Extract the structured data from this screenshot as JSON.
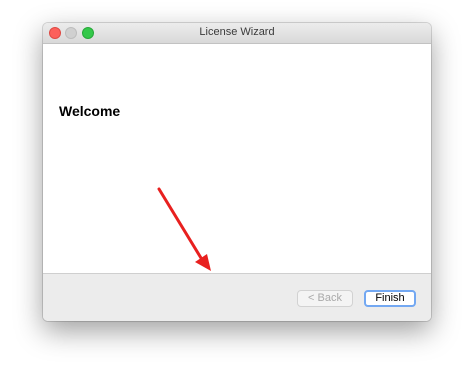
{
  "window": {
    "title": "License Wizard"
  },
  "page": {
    "heading": "Welcome"
  },
  "buttons": {
    "back_label": "< Back",
    "finish_label": "Finish"
  },
  "colors": {
    "close": "#fc605b",
    "minimize": "#d0d0d0",
    "zoom": "#34c84a",
    "annotation_arrow": "#e8201f",
    "default_button_border": "#73a8f2"
  },
  "icons": {
    "annotation": "red-arrow-icon"
  }
}
